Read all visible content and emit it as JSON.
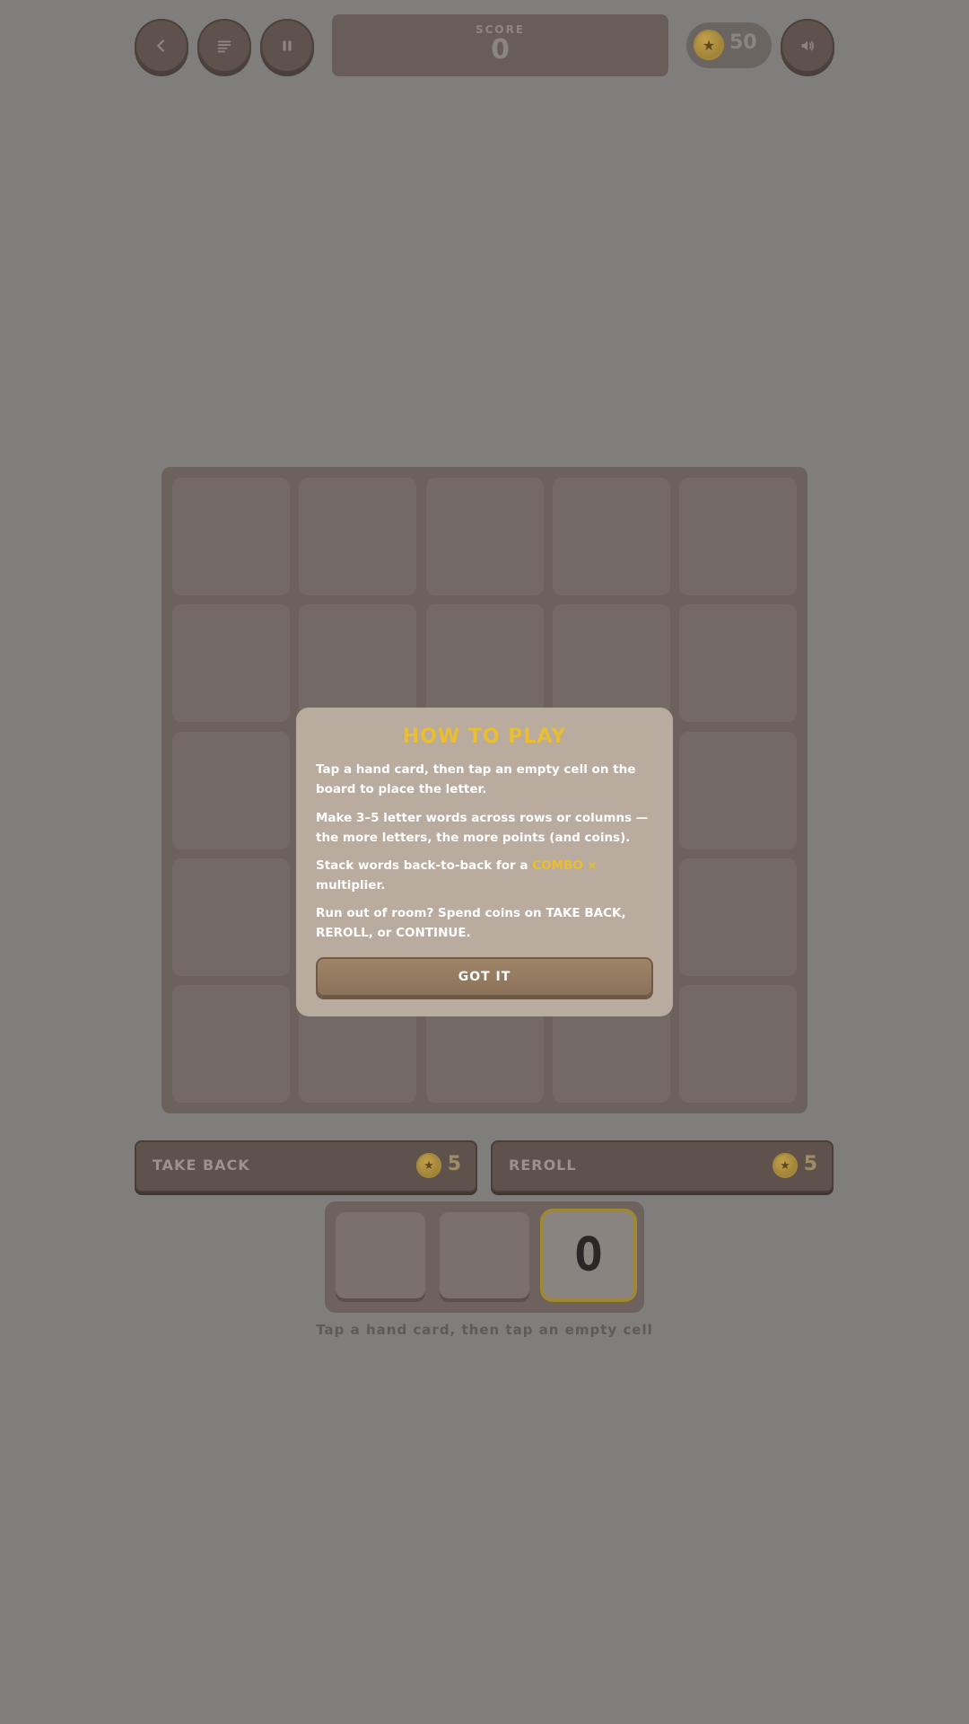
{
  "topbar": {
    "score_label": "SCORE",
    "score_value": "0",
    "coins": "50",
    "buttons": [
      "back-icon",
      "list-icon",
      "pause-icon",
      "sound-icon"
    ]
  },
  "board": {
    "rows": 5,
    "cols": 5
  },
  "actions": {
    "take_back": {
      "label": "TAKE BACK",
      "cost": "5"
    },
    "reroll": {
      "label": "REROLL",
      "cost": "5"
    }
  },
  "hand": {
    "cards": [
      "",
      "",
      "O"
    ],
    "selected_index": 2,
    "hint": "Tap a hand card, then tap an empty cell"
  },
  "modal": {
    "title": "HOW TO PLAY",
    "p1": "Tap a hand card, then tap an empty cell on the board to place the letter.",
    "p2": "Make 3–5 letter words across rows or columns — the more letters, the more points (and coins).",
    "p3_before": "Stack words back-to-back for a ",
    "p3_combo": "COMBO ×",
    "p3_after": " multiplier.",
    "p4": "Run out of room? Spend coins on TAKE BACK, REROLL, or CONTINUE.",
    "button": "GOT IT"
  },
  "colors": {
    "accent_gold": "#eabe2f",
    "overlay": "#7f7e7d",
    "modal_bg": "#b9ab9e"
  }
}
